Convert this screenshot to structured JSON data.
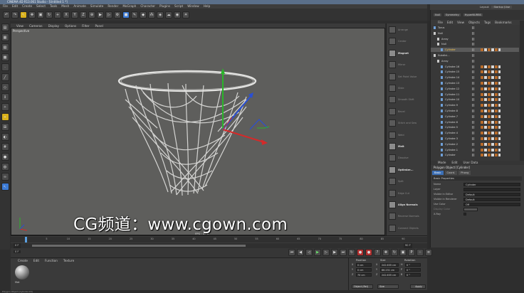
{
  "app": {
    "title": "CINEMA 4D R13.061 Studio - [Untitled 1 *]",
    "layout_label": "Layout:",
    "layout_value": "Startup (Use"
  },
  "menubar": [
    "File",
    "Edit",
    "Create",
    "Select",
    "Tools",
    "Mesh",
    "Animate",
    "Simulate",
    "Render",
    "MoGraph",
    "Character",
    "Plugins",
    "Script",
    "Window",
    "Help"
  ],
  "toolbar": {
    "xyz": [
      "X",
      "Y",
      "Z"
    ]
  },
  "viewport": {
    "menu": [
      "View",
      "Cameras",
      "Display",
      "Options",
      "Filter",
      "Panel"
    ],
    "label": "Perspective",
    "fps": "FPS : 47.6"
  },
  "mesh_tools": [
    {
      "label": "Arrange",
      "on": false
    },
    {
      "label": "Center",
      "on": false
    },
    {
      "label": "Magnet",
      "on": true
    },
    {
      "label": "Mirror",
      "on": false
    },
    {
      "label": "Set Point Value",
      "on": false
    },
    {
      "label": "Slide",
      "on": false
    },
    {
      "label": "Smooth Shift",
      "on": false
    },
    {
      "label": "Bevel",
      "on": false
    },
    {
      "label": "Stitch and Sew",
      "on": false
    },
    {
      "label": "Weld",
      "on": false
    },
    {
      "label": "Melt",
      "on": true
    },
    {
      "label": "Dissolve",
      "on": false
    },
    {
      "label": "Optimize...",
      "on": true
    },
    {
      "label": "Split",
      "on": false
    },
    {
      "label": "Edge Cut",
      "on": false
    },
    {
      "label": "Align Normals",
      "on": true
    },
    {
      "label": "Reverse Normals",
      "on": false
    },
    {
      "label": "Connect Objects",
      "on": false
    },
    {
      "label": "Extrude",
      "on": false
    }
  ],
  "objects_panel": {
    "top_buttons": [
      "Null",
      "Symmetry",
      "HyperNURBS"
    ],
    "menu": [
      "File",
      "Edit",
      "View",
      "Objects",
      "Tags",
      "Bookmarks"
    ],
    "items": [
      {
        "name": "Torus",
        "indent": 0,
        "sel": false
      },
      {
        "name": "Null",
        "indent": 0,
        "sel": false
      },
      {
        "name": "Array",
        "indent": 1,
        "sel": false
      },
      {
        "name": "Null",
        "indent": 1,
        "sel": false
      },
      {
        "name": "Cylinder",
        "indent": 2,
        "sel": true
      },
      {
        "name": "Subdivi...",
        "indent": 0,
        "sel": false
      },
      {
        "name": "Array",
        "indent": 1,
        "sel": false
      },
      {
        "name": "Cylinder.16",
        "indent": 2,
        "sel": false
      },
      {
        "name": "Cylinder.15",
        "indent": 2,
        "sel": false
      },
      {
        "name": "Cylinder.14",
        "indent": 2,
        "sel": false
      },
      {
        "name": "Cylinder.13",
        "indent": 2,
        "sel": false
      },
      {
        "name": "Cylinder.12",
        "indent": 2,
        "sel": false
      },
      {
        "name": "Cylinder.11",
        "indent": 2,
        "sel": false
      },
      {
        "name": "Cylinder.10",
        "indent": 2,
        "sel": false
      },
      {
        "name": "Cylinder.9",
        "indent": 2,
        "sel": false
      },
      {
        "name": "Cylinder.8",
        "indent": 2,
        "sel": false
      },
      {
        "name": "Cylinder.7",
        "indent": 2,
        "sel": false
      },
      {
        "name": "Cylinder.6",
        "indent": 2,
        "sel": false
      },
      {
        "name": "Cylinder.5",
        "indent": 2,
        "sel": false
      },
      {
        "name": "Cylinder.4",
        "indent": 2,
        "sel": false
      },
      {
        "name": "Cylinder.3",
        "indent": 2,
        "sel": false
      },
      {
        "name": "Cylinder.2",
        "indent": 2,
        "sel": false
      },
      {
        "name": "Cylinder.1",
        "indent": 2,
        "sel": false
      },
      {
        "name": "Cylinder",
        "indent": 2,
        "sel": false
      }
    ]
  },
  "attributes": {
    "menu": [
      "Mode",
      "Edit",
      "User Data"
    ],
    "title": "Polygon Object [Cylinder]",
    "tabs": [
      {
        "label": "Basic",
        "on": true
      },
      {
        "label": "Coord.",
        "on": false
      },
      {
        "label": "Phong",
        "on": false
      }
    ],
    "section": "Basic Properties",
    "rows": [
      {
        "label": "Name",
        "value": "Cylinder",
        "dim": false
      },
      {
        "label": "Layer",
        "value": "",
        "dim": false
      },
      {
        "label": "Visible in Editor",
        "value": "Default",
        "dim": false
      },
      {
        "label": "Visible in Renderer",
        "value": "Default",
        "dim": false
      },
      {
        "label": "Use Color",
        "value": "Off",
        "dim": false
      },
      {
        "label": "Display Color",
        "value": "",
        "dim": true
      },
      {
        "label": "X-Ray",
        "value": "",
        "dim": false
      }
    ]
  },
  "timeline": {
    "ticks": [
      "0",
      "5",
      "10",
      "15",
      "20",
      "25",
      "30",
      "35",
      "40",
      "45",
      "50",
      "55",
      "60",
      "65",
      "70",
      "75",
      "80",
      "85",
      "90"
    ],
    "start": "0 F",
    "end": "90 F",
    "current": "0 F"
  },
  "material_panel": {
    "menu": [
      "Create",
      "Edit",
      "Function",
      "Texture"
    ],
    "material_name": "Mat"
  },
  "coordinates": {
    "headers": [
      "Position",
      "Size",
      "Rotation"
    ],
    "axes": [
      "X",
      "Y",
      "Z"
    ],
    "position": [
      "0 cm",
      "0 cm",
      "70 cm"
    ],
    "size": [
      "242.635 cm",
      "86.231 cm",
      "242.635 cm"
    ],
    "rotation": [
      "0 °",
      "0 °",
      "0 °"
    ],
    "rot_labels": [
      "H",
      "P",
      "B"
    ],
    "mode": "Object (Rel)",
    "size_mode": "Size",
    "apply": "Apply"
  },
  "statusbar": "Polygon Object [Cylinder.16]",
  "watermark": "CG频道：www.cgown.com",
  "colors": {
    "axis_x": "#d42a2a",
    "axis_y": "#2ab52a",
    "axis_z": "#2a4fd4",
    "selected_tab": "#3c6fb5",
    "tool_highlight": "#d9b11b"
  }
}
